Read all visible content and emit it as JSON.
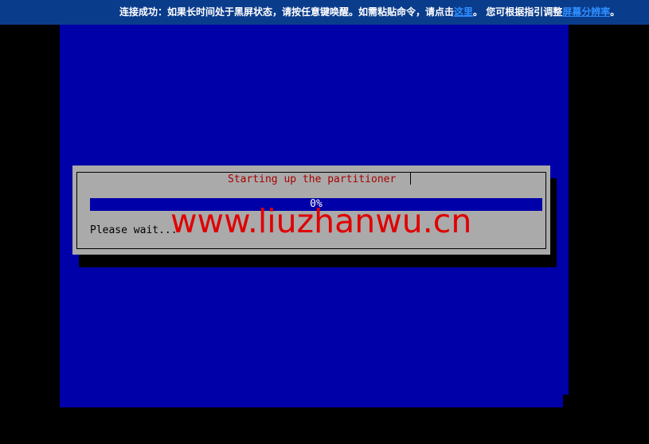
{
  "notice": {
    "text_before_link1": "连接成功：如果长时间处于黑屏状态，请按任意键唤醒。如需粘贴命令，请点击",
    "link1": "这里",
    "text_between": "。 您可根据指引调整",
    "link2": "屏幕分辨率",
    "text_after": "。"
  },
  "dialog": {
    "title": "Starting up the partitioner",
    "progress_label": "0%",
    "progress_fraction": 0,
    "status": "Please wait..."
  },
  "watermark": {
    "text": "www.liuzhanwu.cn"
  },
  "colors": {
    "console_background": "#0000a8",
    "dialog_background": "#aaaaaa",
    "dialog_title": "#a80000",
    "progress_track": "#0000a8",
    "watermark": "#e00000",
    "notice_background": "#0a3c8c",
    "notice_link": "#2f8fff"
  }
}
